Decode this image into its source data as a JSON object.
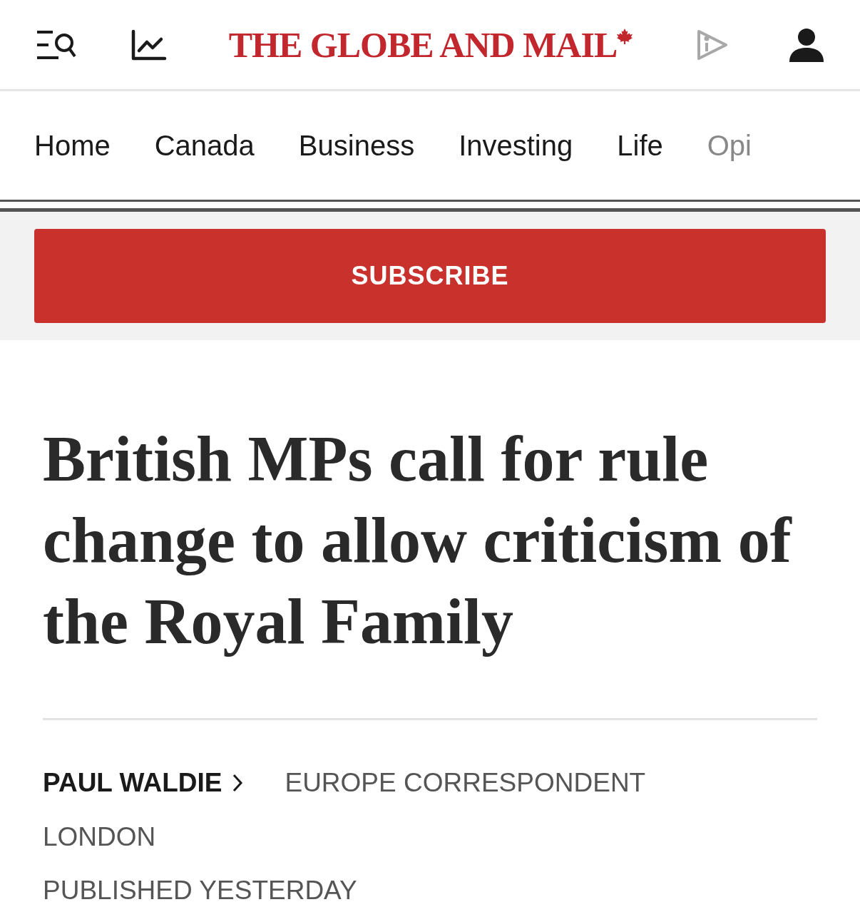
{
  "header": {
    "logo": "THE GLOBE AND MAIL"
  },
  "nav": {
    "items": [
      {
        "label": "Home"
      },
      {
        "label": "Canada"
      },
      {
        "label": "Business"
      },
      {
        "label": "Investing"
      },
      {
        "label": "Life"
      },
      {
        "label": "Opi"
      }
    ]
  },
  "subscribe_button": "SUBSCRIBE",
  "article": {
    "headline": "British MPs call for rule change to allow criticism of the Royal Family",
    "author": "PAUL WALDIE",
    "author_role": "EUROPE CORRESPONDENT",
    "location": "LONDON",
    "published": "PUBLISHED YESTERDAY"
  }
}
